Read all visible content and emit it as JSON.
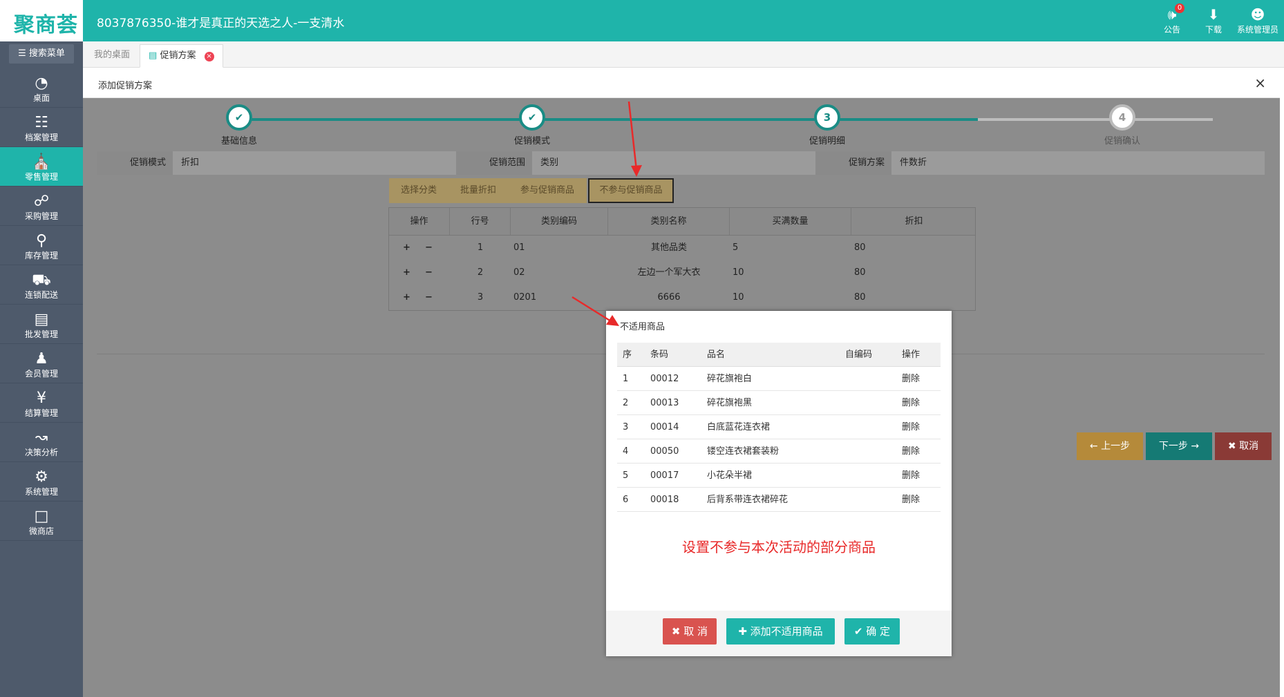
{
  "app": {
    "logo": "聚商荟",
    "title": "8037876350-谁才是真正的天选之人-一支清水",
    "actions": [
      {
        "label": "公告",
        "badge": "0",
        "icon": "megaphone-icon"
      },
      {
        "label": "下载",
        "icon": "download-icon"
      },
      {
        "label": "系统管理员",
        "icon": "avatar-icon"
      }
    ]
  },
  "sidebar": {
    "search_label": "搜索菜单",
    "items": [
      {
        "label": "桌面",
        "icon": "dashboard-icon"
      },
      {
        "label": "档案管理",
        "icon": "archive-icon"
      },
      {
        "label": "零售管理",
        "icon": "store-icon"
      },
      {
        "label": "采购管理",
        "icon": "cart-icon"
      },
      {
        "label": "库存管理",
        "icon": "inventory-icon"
      },
      {
        "label": "连锁配送",
        "icon": "truck-icon"
      },
      {
        "label": "批发管理",
        "icon": "wholesale-icon"
      },
      {
        "label": "会员管理",
        "icon": "member-icon"
      },
      {
        "label": "结算管理",
        "icon": "settlement-icon"
      },
      {
        "label": "决策分析",
        "icon": "analysis-icon"
      },
      {
        "label": "系统管理",
        "icon": "gear-icon"
      },
      {
        "label": "微商店",
        "icon": "shop-bag-icon"
      }
    ]
  },
  "tabs": [
    {
      "label": "我的桌面"
    },
    {
      "label": "促销方案"
    }
  ],
  "panel": {
    "title": "添加促销方案",
    "close": "×"
  },
  "steps": [
    {
      "label": "基础信息",
      "mark": "✔"
    },
    {
      "label": "促销模式",
      "mark": "✔"
    },
    {
      "label": "促销明细",
      "mark": "3"
    },
    {
      "label": "促销确认",
      "mark": "4"
    }
  ],
  "info": [
    {
      "key": "促销模式",
      "value": "折扣"
    },
    {
      "key": "促销范围",
      "value": "类别"
    },
    {
      "key": "促销方案",
      "value": "件数折"
    }
  ],
  "sub_tabs": [
    "选择分类",
    "批量折扣",
    "参与促销商品",
    "不参与促销商品"
  ],
  "grid": {
    "headers": [
      "操作",
      "行号",
      "类别编码",
      "类别名称",
      "买满数量",
      "折扣"
    ],
    "rows": [
      {
        "no": "1",
        "code": "01",
        "name": "其他品类",
        "qty": "5",
        "discount": "80"
      },
      {
        "no": "2",
        "code": "02",
        "name": "左边一个军大衣",
        "qty": "10",
        "discount": "80"
      },
      {
        "no": "3",
        "code": "0201",
        "name": "6666",
        "qty": "10",
        "discount": "80"
      }
    ]
  },
  "nav": {
    "prev": "上一步",
    "next": "下一步",
    "cancel": "取消"
  },
  "dialog": {
    "title": "不适用商品",
    "headers": [
      "序",
      "条码",
      "品名",
      "自编码",
      "操作"
    ],
    "rows": [
      {
        "no": "1",
        "barcode": "00012",
        "name": "碎花旗袍白",
        "own_code": "",
        "action": "删除"
      },
      {
        "no": "2",
        "barcode": "00013",
        "name": "碎花旗袍黑",
        "own_code": "",
        "action": "删除"
      },
      {
        "no": "3",
        "barcode": "00014",
        "name": "白底蓝花连衣裙",
        "own_code": "",
        "action": "删除"
      },
      {
        "no": "4",
        "barcode": "00050",
        "name": "镂空连衣裙套装粉",
        "own_code": "",
        "action": "删除"
      },
      {
        "no": "5",
        "barcode": "00017",
        "name": "小花朵半裙",
        "own_code": "",
        "action": "删除"
      },
      {
        "no": "6",
        "barcode": "00018",
        "name": "后背系带连衣裙碎花",
        "own_code": "",
        "action": "删除"
      }
    ],
    "note": "设置不参与本次活动的部分商品",
    "cancel": "取 消",
    "add": "添加不适用商品",
    "confirm": "确 定"
  },
  "colors": {
    "primary": "#1fb4aa",
    "sidebar": "#4e5a6b",
    "danger": "#d9534f",
    "warning": "#e0a040",
    "annotation": "#e82a2a"
  }
}
